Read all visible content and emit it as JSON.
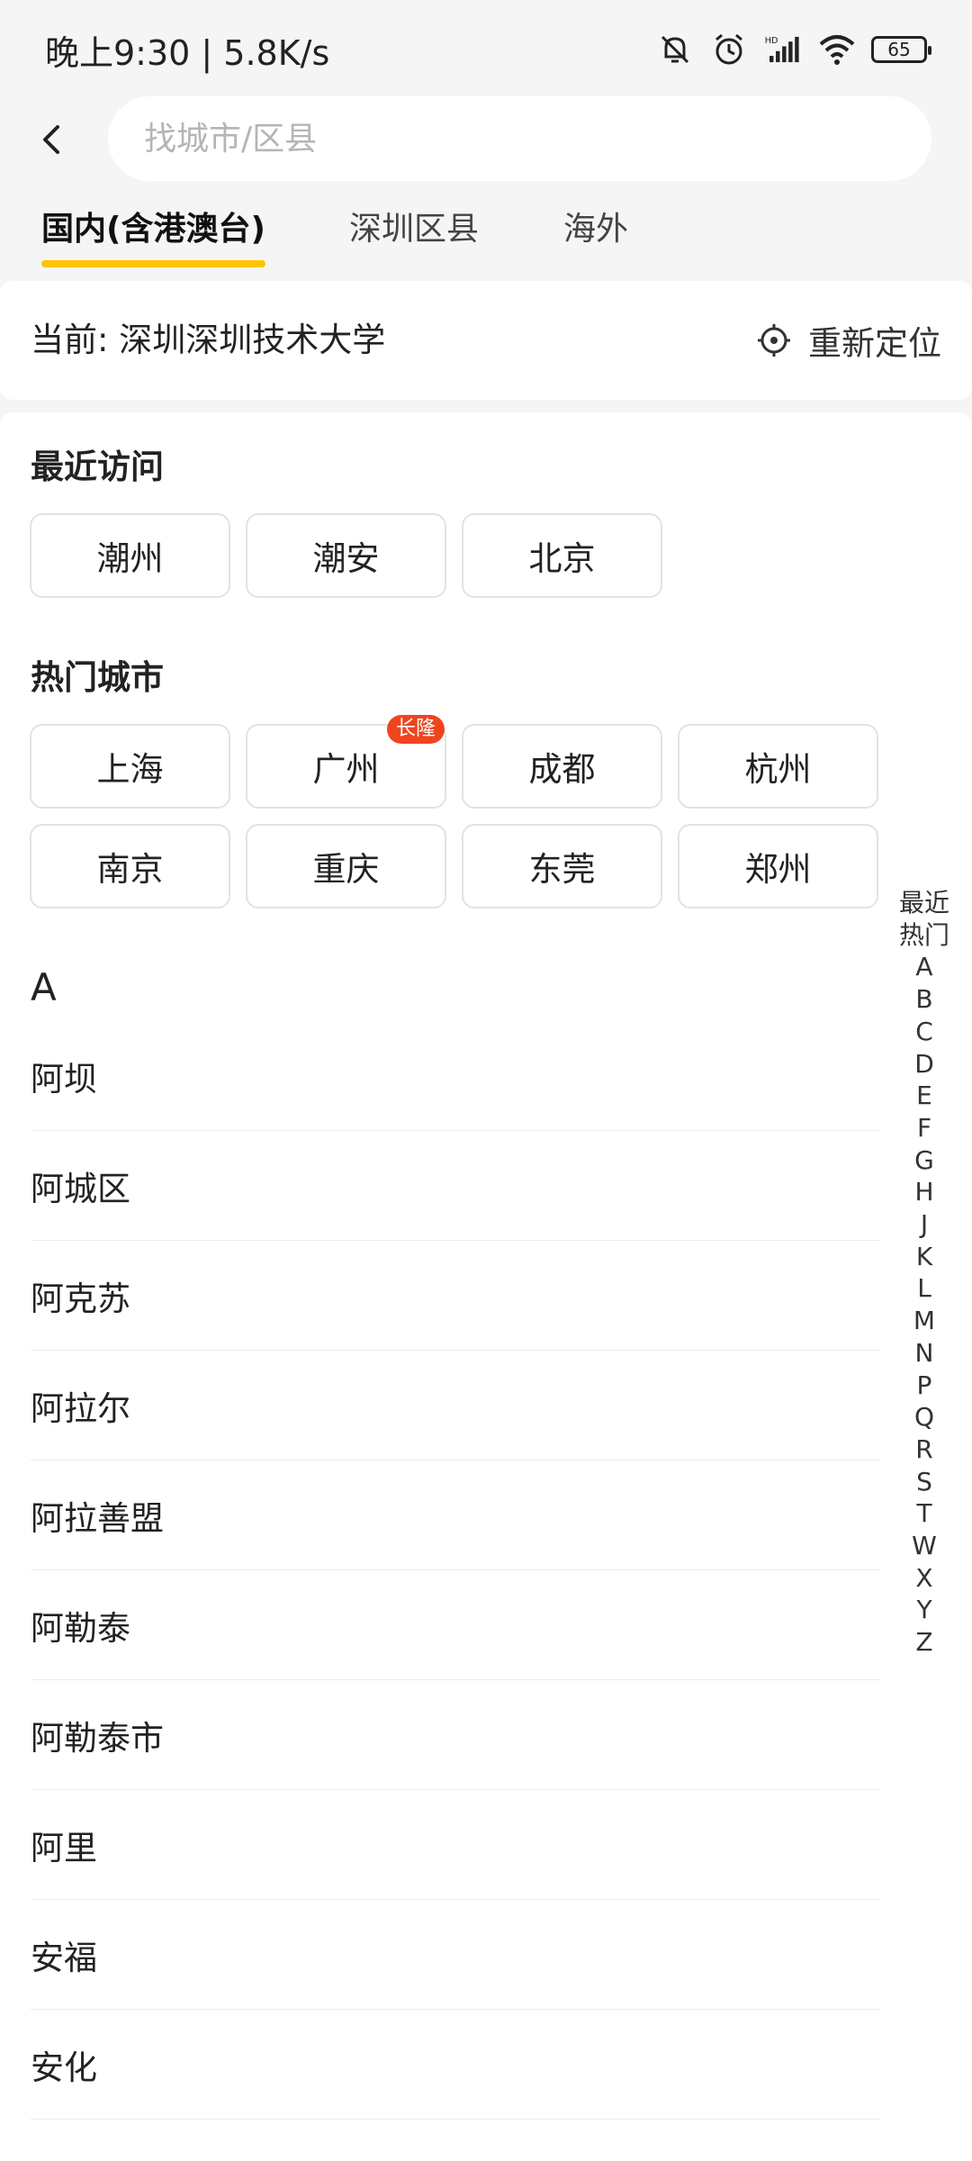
{
  "status_bar": {
    "time": "晚上9:30 | 5.8K/s",
    "battery": "65",
    "icons": [
      "mute-bell-icon",
      "alarm-icon",
      "hd-signal-icon",
      "wifi-icon",
      "battery-icon"
    ]
  },
  "header": {
    "back_icon": "chevron-left-icon",
    "search_placeholder": "找城市/区县"
  },
  "tabs": [
    {
      "label": "国内(含港澳台)",
      "active": true
    },
    {
      "label": "深圳区县",
      "active": false
    },
    {
      "label": "海外",
      "active": false
    }
  ],
  "current_location": {
    "text": "当前: 深圳深圳技术大学",
    "relocate_label": "重新定位",
    "relocate_icon": "locate-target-icon"
  },
  "recent": {
    "title": "最近访问",
    "cities": [
      "潮州",
      "潮安",
      "北京"
    ]
  },
  "hot": {
    "title": "热门城市",
    "cities": [
      "上海",
      "广州",
      "成都",
      "杭州",
      "南京",
      "重庆",
      "东莞",
      "郑州"
    ],
    "badge": {
      "city": "广州",
      "label": "长隆"
    }
  },
  "city_list": {
    "letter": "A",
    "cities": [
      "阿坝",
      "阿城区",
      "阿克苏",
      "阿拉尔",
      "阿拉善盟",
      "阿勒泰",
      "阿勒泰市",
      "阿里",
      "安福",
      "安化"
    ]
  },
  "index_bar": [
    "最近",
    "热门",
    "A",
    "B",
    "C",
    "D",
    "E",
    "F",
    "G",
    "H",
    "J",
    "K",
    "L",
    "M",
    "N",
    "P",
    "Q",
    "R",
    "S",
    "T",
    "W",
    "X",
    "Y",
    "Z"
  ],
  "colors": {
    "accent_underline": "#ffc400",
    "badge_red": "#f0441f",
    "background": "#f5f5f5"
  }
}
